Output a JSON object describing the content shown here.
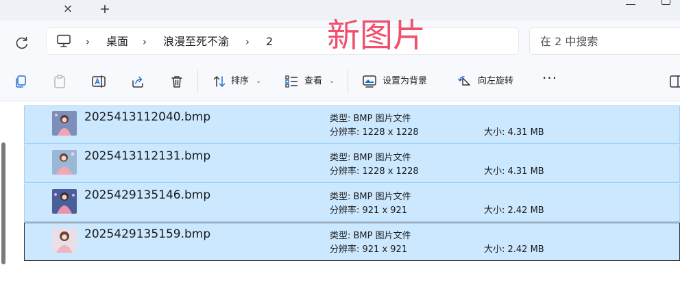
{
  "tabbar": {
    "close_glyph": "×",
    "add_glyph": "+"
  },
  "address": {
    "crumbs": [
      "桌面",
      "浪漫至死不渝",
      "2"
    ],
    "separator": "›"
  },
  "watermark": "新图片",
  "search": {
    "placeholder": "在 2 中搜索"
  },
  "toolbar": {
    "sort_label": "排序",
    "view_label": "查看",
    "set_background_label": "设置为背景",
    "rotate_left_label": "向左旋转",
    "more_glyph": "···",
    "caret": "⌄",
    "icons": [
      "copy-icon",
      "paste-icon",
      "rename-icon",
      "share-icon",
      "delete-icon",
      "sort-icon",
      "view-icon",
      "wallpaper-icon",
      "rotate-left-icon",
      "more-icon",
      "details-pane-icon"
    ]
  },
  "files": [
    {
      "name": "2025413112040.bmp",
      "type": "类型: BMP 图片文件",
      "resolution": "分辨率: 1228 x 1228",
      "size": "大小: 4.31 MB"
    },
    {
      "name": "2025413112131.bmp",
      "type": "类型: BMP 图片文件",
      "resolution": "分辨率: 1228 x 1228",
      "size": "大小: 4.31 MB"
    },
    {
      "name": "2025429135146.bmp",
      "type": "类型: BMP 图片文件",
      "resolution": "分辨率: 921 x 921",
      "size": "大小: 2.42 MB"
    },
    {
      "name": "2025429135159.bmp",
      "type": "类型: BMP 图片文件",
      "resolution": "分辨率: 921 x 921",
      "size": "大小: 2.42 MB"
    }
  ],
  "colors": {
    "selection_fill": "#cce8ff",
    "selection_border": "#99d1ff",
    "watermark": "#f0506e"
  }
}
